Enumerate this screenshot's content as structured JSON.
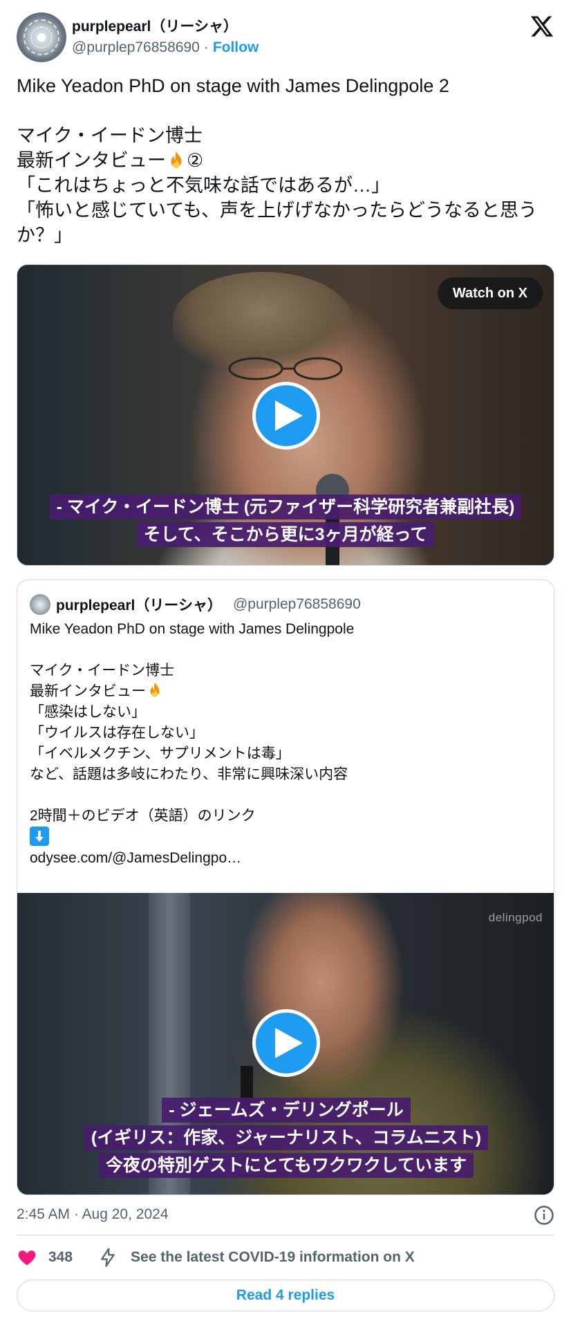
{
  "author": {
    "display_name": "purplepearl（リーシャ）",
    "handle": "@purplep76858690",
    "separator": "·",
    "follow_label": "Follow"
  },
  "tweet": {
    "line1": "Mike Yeadon PhD on stage with James Delingpole 2",
    "line2": "マイク・イードン博士",
    "line3_prefix": "最新インタビュー",
    "line3_suffix": "②",
    "line4": "「これはちょっと不気味な話ではあるが…」",
    "line5": "「怖いと感じていても、声を上げげなかったらどうなると思うか？」"
  },
  "media": {
    "watch_label": "Watch on X",
    "subtitle_1": "- マイク・イードン博士 (元ファイザー科学研究者兼副社長)",
    "subtitle_2": "そして、そこから更に3ヶ月が経って"
  },
  "quote": {
    "display_name": "purplepearl（リーシャ）",
    "handle": "@purplep76858690",
    "line1": "Mike Yeadon PhD on stage with James Delingpole",
    "line2": "マイク・イードン博士",
    "line3": "最新インタビュー",
    "line4": "「感染はしない」",
    "line5": "「ウイルスは存在しない」",
    "line6": "「イベルメクチン、サプリメントは毒」",
    "line7": "など、話題は多岐にわたり、非常に興味深い内容",
    "line8": "2時間＋のビデオ（英語）のリンク",
    "line9": "odysee.com/@JamesDelingpo…",
    "media_watermark": "delingpod",
    "subtitle_1": "- ジェームズ・デリングポール",
    "subtitle_2": "(イギリス：作家、ジャーナリスト、コラムニスト)",
    "subtitle_3": "今夜の特別ゲストにとてもワクワクしています"
  },
  "footer": {
    "timestamp": "2:45 AM · Aug 20, 2024",
    "like_count": "348",
    "covid_info": "See the latest COVID-19 information on X",
    "read_replies": "Read 4 replies"
  },
  "icons": {
    "heart_color": "#f91880",
    "accent": "#1d9bf0"
  }
}
